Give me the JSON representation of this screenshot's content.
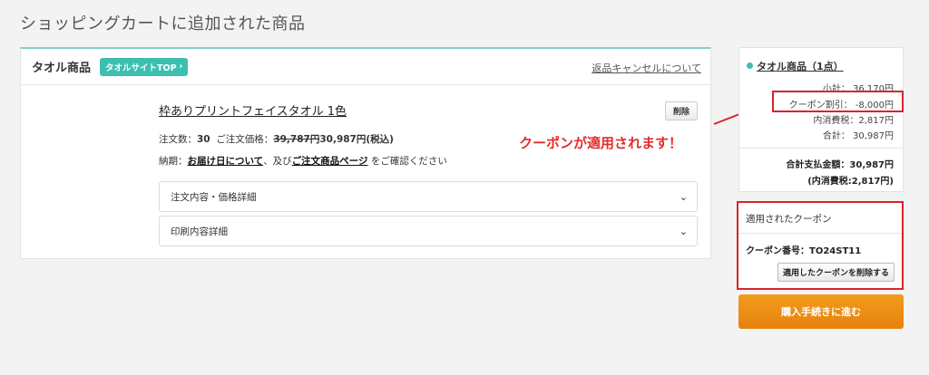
{
  "page": {
    "title": "ショッピングカートに追加された商品"
  },
  "cart": {
    "title": "タオル商品",
    "badge": "タオルサイトTOP",
    "return_link": "返品キャンセルについて",
    "item": {
      "name": "枠ありプリントフェイスタオル 1色",
      "delete_label": "削除",
      "qty_label": "注文数：",
      "qty": "30",
      "price_label": "ご注文価格：",
      "price_old": "39,787円",
      "price_new": "30,987円(税込)",
      "delivery_prefix": "納期：",
      "delivery_link": "お届け日について",
      "delivery_mid": "、及び",
      "order_page_link": "ご注文商品ページ",
      "delivery_suffix": "をご確認ください",
      "accordion1": "注文内容・価格詳細",
      "accordion2": "印刷内容詳細"
    }
  },
  "annotation": {
    "note": "クーポンが適用されます！"
  },
  "summary": {
    "title": "タオル商品（1点）",
    "subtotal": "小計： 36,170円",
    "coupon": "クーポン割引： -8,000円",
    "tax": "内消費税：2,817円",
    "total": "合計： 30,987円",
    "grand_total": "合計支払金額：30,987円",
    "grand_tax": "(内消費税:2,817円)"
  },
  "coupon": {
    "heading": "適用されたクーポン",
    "code": "クーポン番号：TO24ST11",
    "remove_label": "適用したクーポンを削除する"
  },
  "checkout": {
    "label": "購入手続きに進む"
  },
  "colors": {
    "accent": "#3cbfb0",
    "alert": "#d9232b",
    "checkout": "#f0931a"
  },
  "icons": [
    "chevron-right-icon",
    "chevron-down-icon",
    "dot-icon"
  ]
}
